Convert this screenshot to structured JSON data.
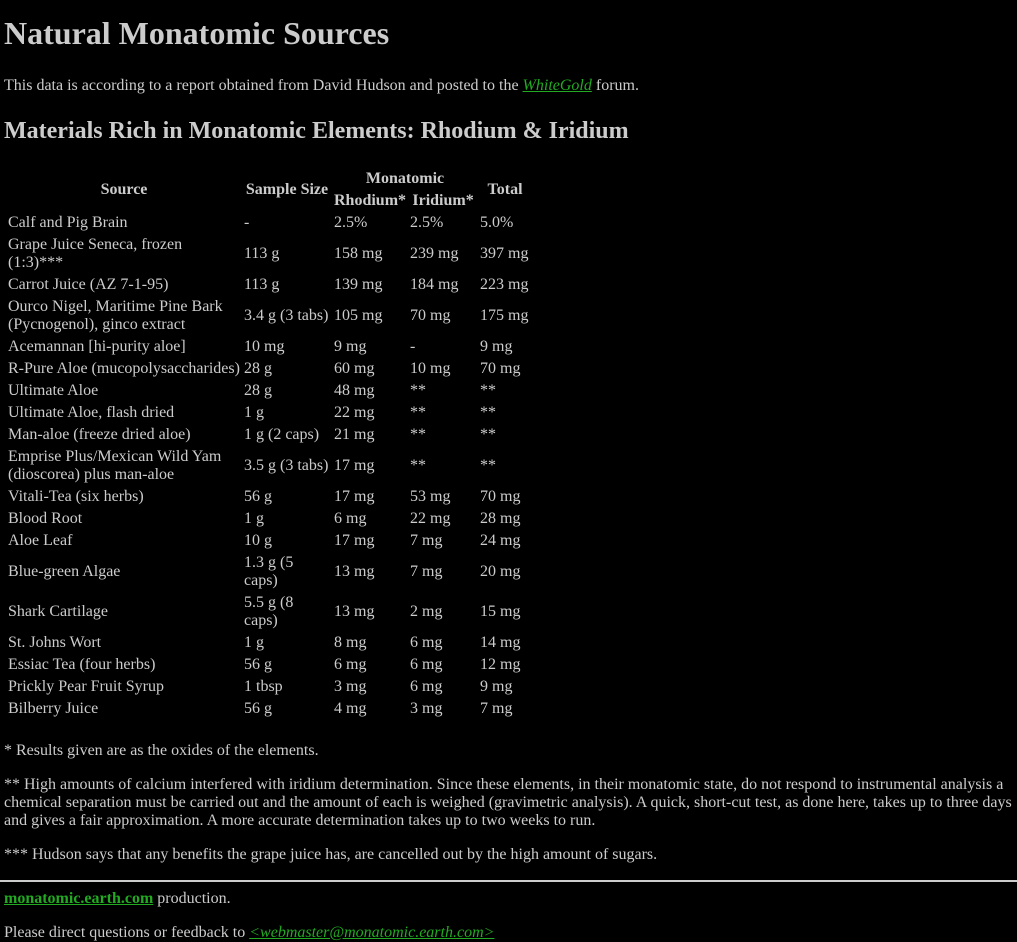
{
  "page_title": "Natural Monatomic Sources",
  "intro": {
    "prefix": "This data is according to a report obtained from David Hudson and posted to the ",
    "link": "WhiteGold",
    "suffix": " forum."
  },
  "section_title": "Materials Rich in Monatomic Elements: Rhodium & Iridium",
  "table": {
    "headers": {
      "source": "Source",
      "sample_size": "Sample Size",
      "monatomic": "Monatomic",
      "rhodium": "Rhodium*",
      "iridium": "Iridium*",
      "total": "Total"
    },
    "rows": [
      {
        "source": "Calf and Pig Brain",
        "sample": "-",
        "rhodium": "2.5%",
        "iridium": "2.5%",
        "total": "5.0%"
      },
      {
        "source": "Grape Juice Seneca, frozen (1:3)***",
        "sample": "113 g",
        "rhodium": "158 mg",
        "iridium": "239 mg",
        "total": "397 mg"
      },
      {
        "source": "Carrot Juice (AZ 7-1-95)",
        "sample": "113 g",
        "rhodium": "139 mg",
        "iridium": "184 mg",
        "total": "223 mg"
      },
      {
        "source": "Ourco Nigel, Maritime Pine Bark",
        "source2": "(Pycnogenol), ginco extract",
        "sample": "3.4 g (3 tabs)",
        "rhodium": "105 mg",
        "iridium": "70 mg",
        "total": "175 mg"
      },
      {
        "source": "Acemannan [hi-purity aloe]",
        "sample": "10 mg",
        "rhodium": "9 mg",
        "iridium": "-",
        "total": "9 mg"
      },
      {
        "source": "R-Pure Aloe (mucopolysaccharides)",
        "sample": "28 g",
        "rhodium": "60 mg",
        "iridium": "10 mg",
        "total": "70 mg"
      },
      {
        "source": "Ultimate Aloe",
        "sample": "28 g",
        "rhodium": "48 mg",
        "iridium": "**",
        "total": "**"
      },
      {
        "source": "Ultimate Aloe, flash dried",
        "sample": "1 g",
        "rhodium": "22 mg",
        "iridium": "**",
        "total": "**"
      },
      {
        "source": "Man-aloe (freeze dried aloe)",
        "sample": "1 g (2 caps)",
        "rhodium": "21 mg",
        "iridium": "**",
        "total": "**"
      },
      {
        "source": "Emprise Plus/Mexican Wild Yam",
        "source2": "(dioscorea) plus man-aloe",
        "sample": "3.5 g (3 tabs)",
        "rhodium": "17 mg",
        "iridium": "**",
        "total": "**"
      },
      {
        "source": "Vitali-Tea (six herbs)",
        "sample": "56 g",
        "rhodium": "17 mg",
        "iridium": "53 mg",
        "total": "70 mg"
      },
      {
        "source": "Blood Root",
        "sample": "1 g",
        "rhodium": "6 mg",
        "iridium": "22 mg",
        "total": "28 mg"
      },
      {
        "source": "Aloe Leaf",
        "sample": "10 g",
        "rhodium": "17 mg",
        "iridium": "7 mg",
        "total": "24 mg"
      },
      {
        "source": "Blue-green Algae",
        "sample": "1.3 g (5 caps)",
        "rhodium": "13 mg",
        "iridium": "7 mg",
        "total": "20 mg"
      },
      {
        "source": "Shark Cartilage",
        "sample": "5.5 g (8 caps)",
        "rhodium": "13 mg",
        "iridium": "2 mg",
        "total": "15 mg"
      },
      {
        "source": "St. Johns Wort",
        "sample": "1 g",
        "rhodium": "8 mg",
        "iridium": "6 mg",
        "total": "14 mg"
      },
      {
        "source": "Essiac Tea (four herbs)",
        "sample": "56 g",
        "rhodium": "6 mg",
        "iridium": "6 mg",
        "total": "12 mg"
      },
      {
        "source": "Prickly Pear Fruit Syrup",
        "sample": "1 tbsp",
        "rhodium": "3 mg",
        "iridium": "6 mg",
        "total": "9 mg"
      },
      {
        "source": "Bilberry Juice",
        "sample": "56 g",
        "rhodium": "4 mg",
        "iridium": "3 mg",
        "total": "7 mg"
      }
    ]
  },
  "notes": {
    "note1": "* Results given are as the oxides of the elements.",
    "note2": "** High amounts of calcium interfered with iridium determination. Since these elements, in their monatomic state, do not respond to instrumental analysis a chemical separation must be carried out and the amount of each is weighed (gravimetric analysis). A quick, short-cut test, as done here, takes up to three days and gives a fair approximation. A more accurate determination takes up to two weeks to run.",
    "note3": "*** Hudson says that any benefits the grape juice has, are cancelled out by the high amount of sugars."
  },
  "footer": {
    "site_link": "monatomic.earth.com",
    "site_suffix": " production.",
    "contact_prefix": "Please direct questions or feedback to ",
    "contact_link": "<webmaster@monatomic.earth.com>"
  },
  "colors": {
    "background": "#000000",
    "text": "#cccccc",
    "link": "#22aa22"
  }
}
